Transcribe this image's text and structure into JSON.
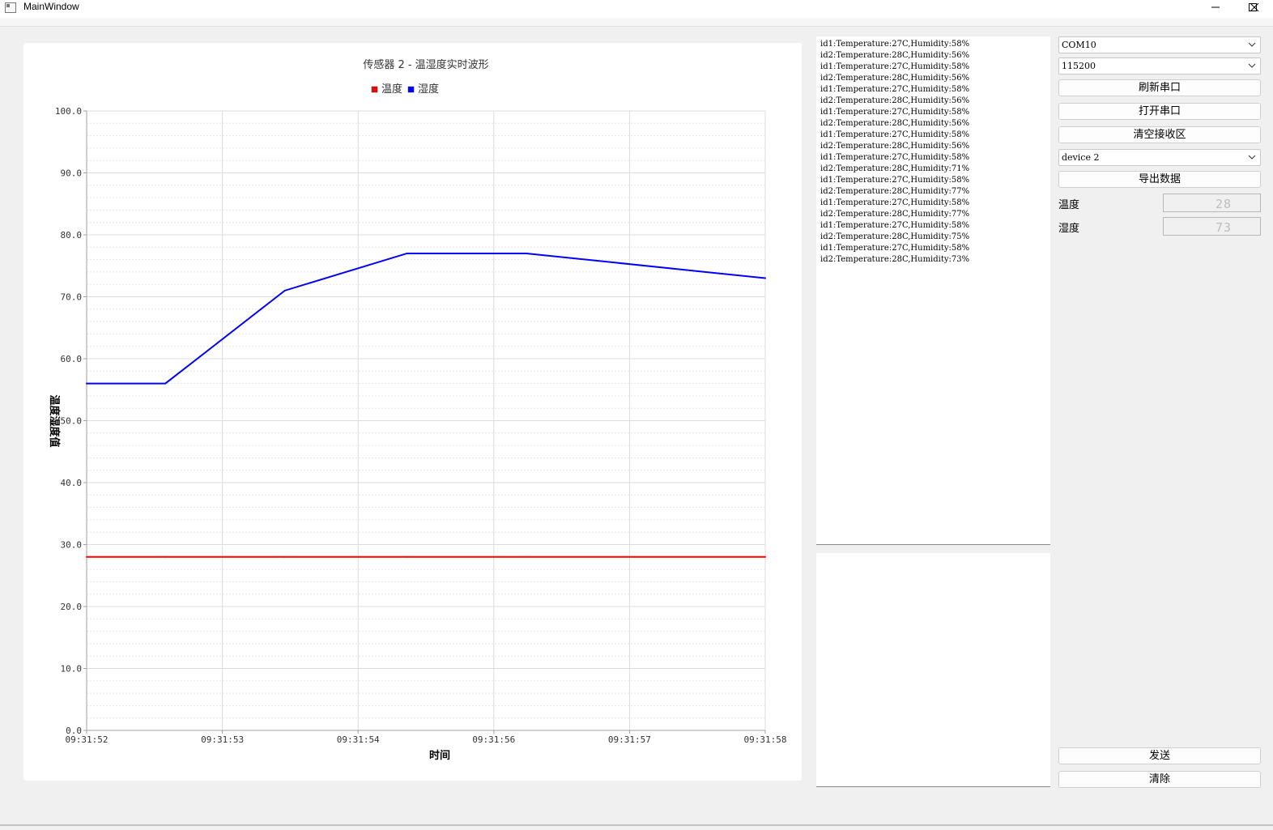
{
  "window": {
    "title": "MainWindow"
  },
  "chart_data": {
    "type": "line",
    "title": "传感器 2 - 温湿度实时波形",
    "xlabel": "时间",
    "ylabel": "温度湿度值",
    "ylim": [
      0,
      100
    ],
    "yticks": [
      "0.0",
      "10.0",
      "20.0",
      "30.0",
      "40.0",
      "50.0",
      "60.0",
      "70.0",
      "80.0",
      "90.0",
      "100.0"
    ],
    "x_tick_labels": [
      "09:31:52",
      "09:31:53",
      "09:31:54",
      "09:31:56",
      "09:31:57",
      "09:31:58"
    ],
    "x": [
      0,
      0.58,
      1.46,
      2.36,
      3.24,
      5.0
    ],
    "series": [
      {
        "name": "温度",
        "color": "#ff0000",
        "values": [
          28,
          28,
          28,
          28,
          28,
          28
        ]
      },
      {
        "name": "湿度",
        "color": "#0000ff",
        "values": [
          56,
          56,
          71,
          77,
          77,
          73
        ]
      }
    ],
    "grid": true,
    "legend": "top-center"
  },
  "receive": {
    "lines": [
      "id1:Temperature:27C,Humidity:58%",
      "id2:Temperature:28C,Humidity:56%",
      "id1:Temperature:27C,Humidity:58%",
      "id2:Temperature:28C,Humidity:56%",
      "id1:Temperature:27C,Humidity:58%",
      "id2:Temperature:28C,Humidity:56%",
      "id1:Temperature:27C,Humidity:58%",
      "id2:Temperature:28C,Humidity:56%",
      "id1:Temperature:27C,Humidity:58%",
      "id2:Temperature:28C,Humidity:56%",
      "id1:Temperature:27C,Humidity:58%",
      "id2:Temperature:28C,Humidity:71%",
      "id1:Temperature:27C,Humidity:58%",
      "id2:Temperature:28C,Humidity:77%",
      "id1:Temperature:27C,Humidity:58%",
      "id2:Temperature:28C,Humidity:77%",
      "id1:Temperature:27C,Humidity:58%",
      "id2:Temperature:28C,Humidity:75%",
      "id1:Temperature:27C,Humidity:58%",
      "id2:Temperature:28C,Humidity:73%"
    ]
  },
  "controls": {
    "port": "COM10",
    "baud": "115200",
    "refresh_label": "刷新串口",
    "open_label": "打开串口",
    "clear_recv_label": "清空接收区",
    "device": "device 2",
    "export_label": "导出数据",
    "temp_label": "温度",
    "temp_value": "28",
    "hum_label": "湿度",
    "hum_value": "73",
    "send_label": "发送",
    "clear_label": "清除"
  }
}
